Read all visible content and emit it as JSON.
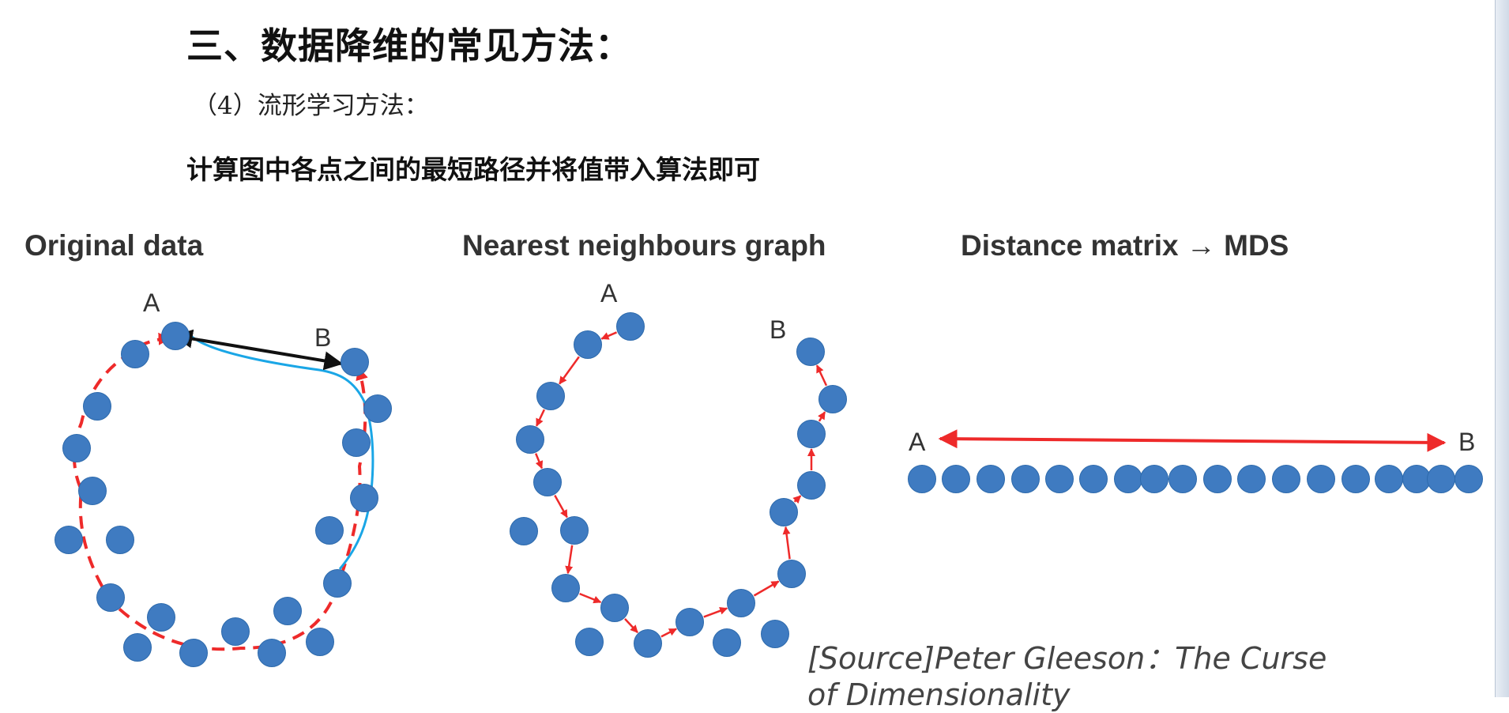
{
  "slide": {
    "heading": "三、数据降维的常见方法：",
    "subheading": "（4）流形学习方法：",
    "description": "计算图中各点之间的最短路径并将值带入算法即可",
    "source": "[Source]Peter Gleeson：The Curse of Dimensionality"
  },
  "panels": [
    {
      "title": "Original data",
      "label_a": "A",
      "label_b": "B"
    },
    {
      "title": "Nearest neighbours graph",
      "label_a": "A",
      "label_b": "B"
    },
    {
      "title": "Distance matrix → MDS",
      "label_a": "A",
      "label_b": "B"
    }
  ],
  "colors": {
    "point": "#3f7bc1",
    "point_stroke": "#2d6aac",
    "arrow_red": "#ee2a2a",
    "arrow_black": "#111111",
    "geodesic_blue": "#1aa6e6"
  },
  "mds_point_count": 17
}
